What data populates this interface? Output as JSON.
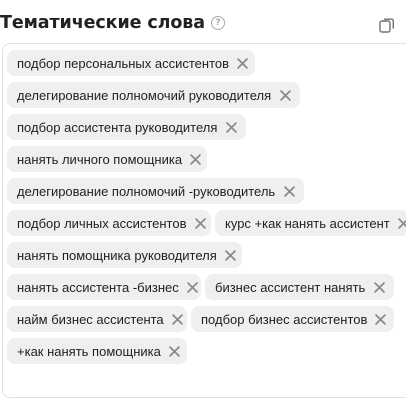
{
  "header": {
    "title": "Тематические слова",
    "help_icon_glyph": "?",
    "help_icon": "question-circle-icon",
    "copy_icon": "copy-icon"
  },
  "tags": [
    "подбор персональных ассистентов",
    "делегирование полномочий руководителя",
    "подбор ассистента руководителя",
    "нанять личного помощника",
    "делегирование полномочий -руководитель",
    "подбор личных ассистентов",
    "курс +как нанять ассистент",
    "нанять помощника руководителя",
    "нанять ассистента -бизнес",
    "бизнес ассистент нанять",
    "найм бизнес ассистента",
    "подбор бизнес ассистентов",
    "+как нанять помощника"
  ],
  "tag_remove_icon": "close-icon",
  "colors": {
    "tag_background": "#efeff1",
    "remove_icon": "#8a8a8a",
    "border": "#e1e1e1"
  }
}
